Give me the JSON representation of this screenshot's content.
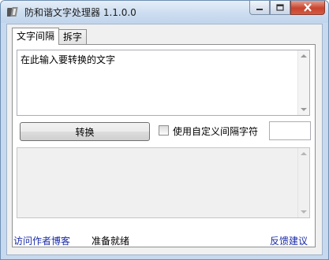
{
  "window": {
    "title": "防和谐文字处理器 1.1.0.0",
    "icons": {
      "app": "app-icon",
      "minimize": "minimize-icon",
      "maximize": "maximize-icon",
      "close": "close-icon"
    }
  },
  "tabs": [
    {
      "label": "文字间隔",
      "active": true
    },
    {
      "label": "拆字",
      "active": false
    }
  ],
  "input": {
    "value": "在此输入要转换的文字"
  },
  "convert_button": {
    "label": "转换"
  },
  "custom_separator": {
    "label": "使用自定义间隔字符",
    "checked": false,
    "value": ""
  },
  "output": {
    "value": ""
  },
  "statusbar": {
    "blog_link": "访问作者博客",
    "status": "准备就绪",
    "feedback_link": "反馈建议"
  },
  "colors": {
    "link": "#1a2ba8",
    "close_button": "#c7442e"
  }
}
